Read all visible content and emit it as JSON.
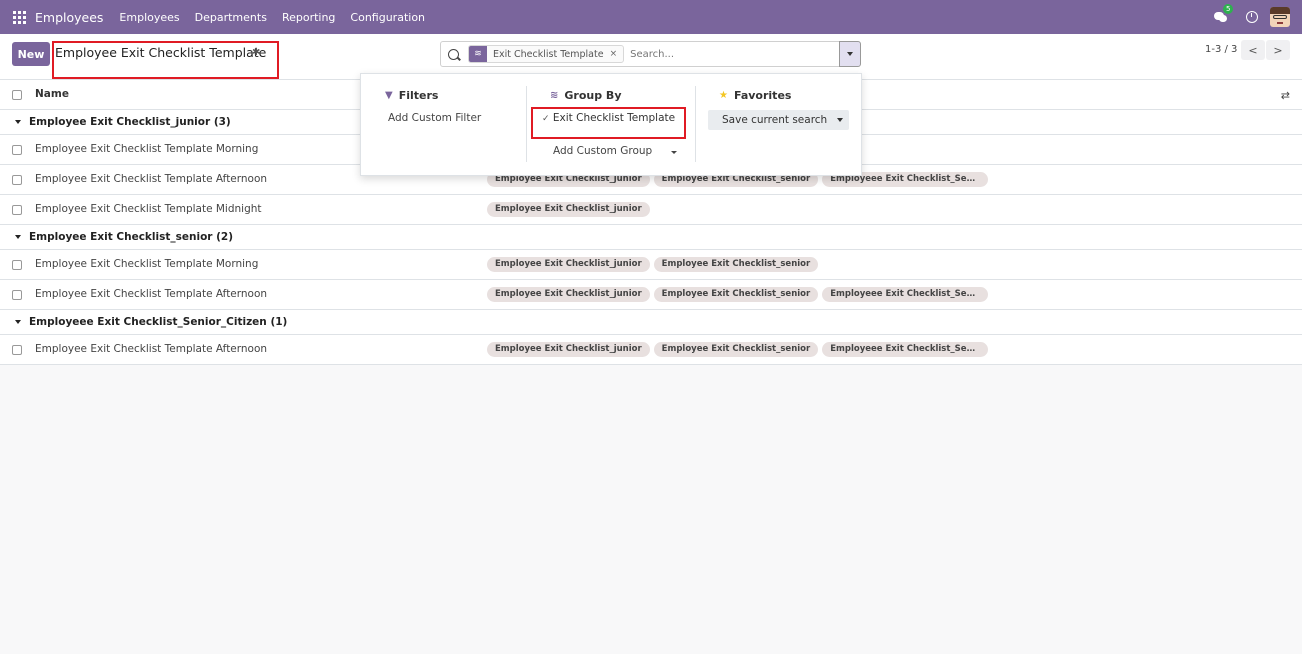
{
  "navbar": {
    "app_title": "Employees",
    "menu": [
      "Employees",
      "Departments",
      "Reporting",
      "Configuration"
    ],
    "chat_badge": "5"
  },
  "control_panel": {
    "new_button": "New",
    "breadcrumb_title": "Employee Exit Checklist Template",
    "search": {
      "facet_label": "Exit Checklist Template",
      "facet_remove": "×",
      "placeholder": "Search..."
    },
    "pager": {
      "value": "1-3 / 3",
      "prev": "<",
      "next": ">"
    }
  },
  "list": {
    "header": {
      "name_col": "Name"
    },
    "groups": [
      {
        "label": "Employee Exit Checklist_junior (3)",
        "rows": [
          {
            "name": "Employee Exit Checklist Template Morning",
            "tags": []
          },
          {
            "name": "Employee Exit Checklist Template Afternoon",
            "tags": [
              "Employee Exit Checklist_junior",
              "Employee Exit Checklist_senior",
              "Employeee Exit Checklist_Seni..."
            ]
          },
          {
            "name": "Employee Exit Checklist Template Midnight",
            "tags": [
              "Employee Exit Checklist_junior"
            ]
          }
        ]
      },
      {
        "label": "Employee Exit Checklist_senior (2)",
        "rows": [
          {
            "name": "Employee Exit Checklist Template Morning",
            "tags": [
              "Employee Exit Checklist_junior",
              "Employee Exit Checklist_senior"
            ]
          },
          {
            "name": "Employee Exit Checklist Template Afternoon",
            "tags": [
              "Employee Exit Checklist_junior",
              "Employee Exit Checklist_senior",
              "Employeee Exit Checklist_Seni..."
            ]
          }
        ]
      },
      {
        "label": "Employeee Exit Checklist_Senior_Citizen (1)",
        "rows": [
          {
            "name": "Employee Exit Checklist Template Afternoon",
            "tags": [
              "Employee Exit Checklist_junior",
              "Employee Exit Checklist_senior",
              "Employeee Exit Checklist_Seni..."
            ]
          }
        ]
      }
    ]
  },
  "dropdown": {
    "filters": {
      "title": "Filters",
      "add_custom": "Add Custom Filter"
    },
    "group_by": {
      "title": "Group By",
      "selected": "Exit Checklist Template",
      "add_custom": "Add Custom Group"
    },
    "favorites": {
      "title": "Favorites",
      "save": "Save current search"
    }
  },
  "colors": {
    "brand": "#7a659c",
    "highlight": "#e01b24",
    "tag_bg": "#e8e0df"
  }
}
